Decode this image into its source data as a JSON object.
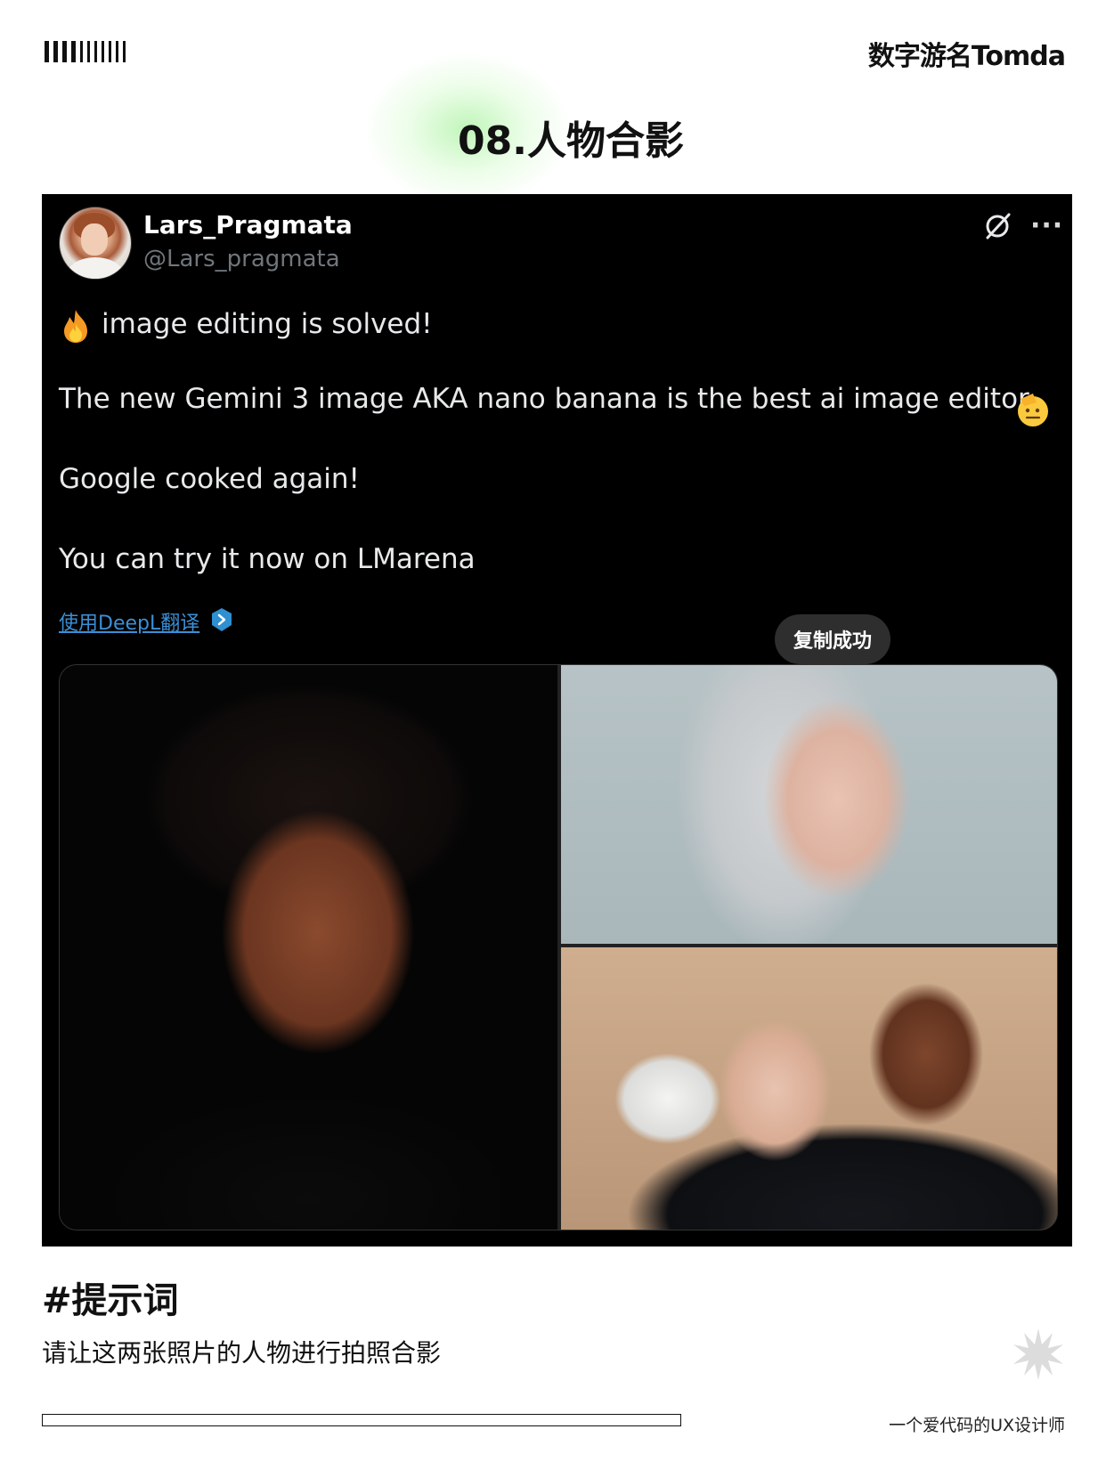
{
  "header": {
    "brand": "数字游名Tomda",
    "section_title": "08.人物合影"
  },
  "tweet": {
    "display_name": "Lars_Pragmata",
    "handle": "@Lars_pragmata",
    "lines": [
      "image editing is solved!",
      "The new Gemini 3 image AKA nano banana is the best ai image editor",
      "Google cooked again!",
      "You can try it now on LMarena"
    ],
    "translate_link": "使用DeepL翻译",
    "more_label": "···",
    "toast": "复制成功"
  },
  "prompt": {
    "heading": "#提示词",
    "body": "请让这两张照片的人物进行拍照合影"
  },
  "footer": {
    "note": "一个爱代码的UX设计师"
  },
  "icons": {
    "barcode": "barcode-icon",
    "grok": "grok-icon",
    "more": "more-icon",
    "fire": "fire-emoji-icon",
    "face": "saluting-face-emoji-icon",
    "deepl": "deepl-icon",
    "star": "starburst-icon"
  },
  "colors": {
    "card_background": "#000000",
    "text_primary": "#e7e9ea",
    "text_secondary": "#71767b",
    "link": "#3b8fd6",
    "accent_glow": "#a0f096"
  }
}
